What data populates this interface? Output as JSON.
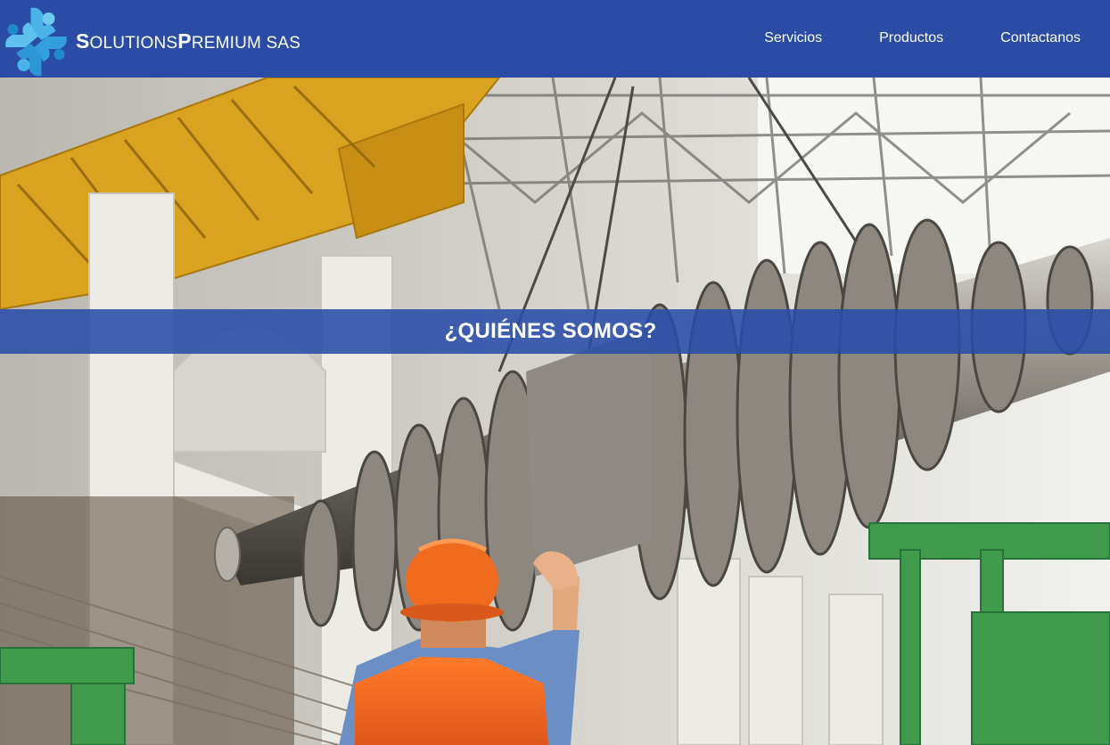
{
  "brand": {
    "initial_1": "S",
    "rest_1": "OLUTIONS",
    "initial_2": "P",
    "rest_2": "REMIUM SAS",
    "logo_icon": "puzzle-cross-logo"
  },
  "nav": {
    "items": [
      {
        "label": "Servicios"
      },
      {
        "label": "Productos"
      },
      {
        "label": "Contactanos"
      }
    ]
  },
  "hero": {
    "image_subject": "factory-worker-turbine-rotor",
    "section_title": "¿QUIÉNES SOMOS?"
  },
  "colors": {
    "nav_bg": "#2a4ca4",
    "band_bg": "#294ca8",
    "logo_light": "#4ab3e8",
    "logo_dark": "#1f8ac9",
    "text": "#ffffff"
  }
}
